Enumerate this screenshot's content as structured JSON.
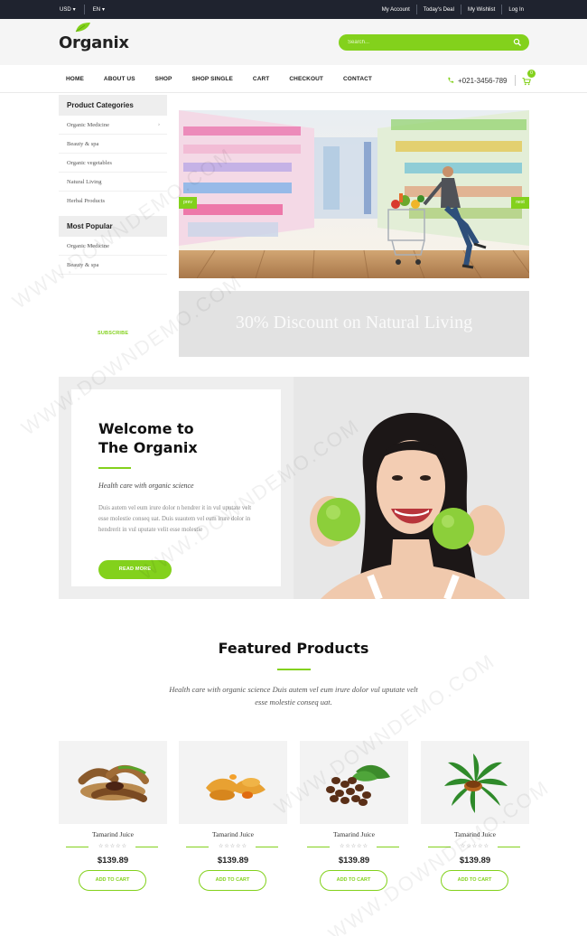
{
  "topbar": {
    "currency": "USD",
    "language": "EN",
    "links": [
      "My Account",
      "Today's Deal",
      "My Wishlist",
      "Log In"
    ]
  },
  "header": {
    "logo": "Organix",
    "search_placeholder": "Search..."
  },
  "nav": {
    "items": [
      "HOME",
      "ABOUT US",
      "SHOP",
      "SHOP SINGLE",
      "CART",
      "CHECKOUT",
      "CONTACT"
    ],
    "phone": "+021-3456-789",
    "cart_count": "0"
  },
  "sidebar": {
    "categories_title": "Product Categories",
    "categories": [
      "Organic Medicine",
      "Beauty & spa",
      "Organic vegetables",
      "Natural Living",
      "Herbal Products"
    ],
    "popular_title": "Most Popular",
    "popular": [
      "Organic Medicine",
      "Beauty & spa"
    ],
    "subscribe": "SUBSCRIBE"
  },
  "slider": {
    "prev": "prev",
    "next": "next"
  },
  "promo": {
    "text": "30% Discount on Natural Living"
  },
  "welcome": {
    "title_line1": "Welcome to",
    "title_line2": "The Organix",
    "subtitle": "Health care with organic science",
    "body": "Duis autem vel eum irure dolor n hendrer it in vul uputate velt esse molestie conseq uat. Duis suautem vel eum irure dolor in hendrerit in vul uputate velit esse molestie",
    "button": "READ MORE"
  },
  "featured": {
    "title": "Featured Products",
    "subtitle": "Health care with organic science Duis autem vel eum irure dolor vul uputate velt esse molestie conseq uat.",
    "products": [
      {
        "name": "Tamarind Juice",
        "price": "$139.89",
        "button": "ADD TO CART",
        "stars": "☆☆☆☆☆"
      },
      {
        "name": "Tamarind Juice",
        "price": "$139.89",
        "button": "ADD TO CART",
        "stars": "☆☆☆☆☆"
      },
      {
        "name": "Tamarind Juice",
        "price": "$139.89",
        "button": "ADD TO CART",
        "stars": "☆☆☆☆☆"
      },
      {
        "name": "Tamarind Juice",
        "price": "$139.89",
        "button": "ADD TO CART",
        "stars": "☆☆☆☆☆"
      }
    ]
  },
  "watermark": "WWW.DOWNDEMO.COM",
  "colors": {
    "accent": "#83d11c",
    "topbar": "#1f232f"
  }
}
